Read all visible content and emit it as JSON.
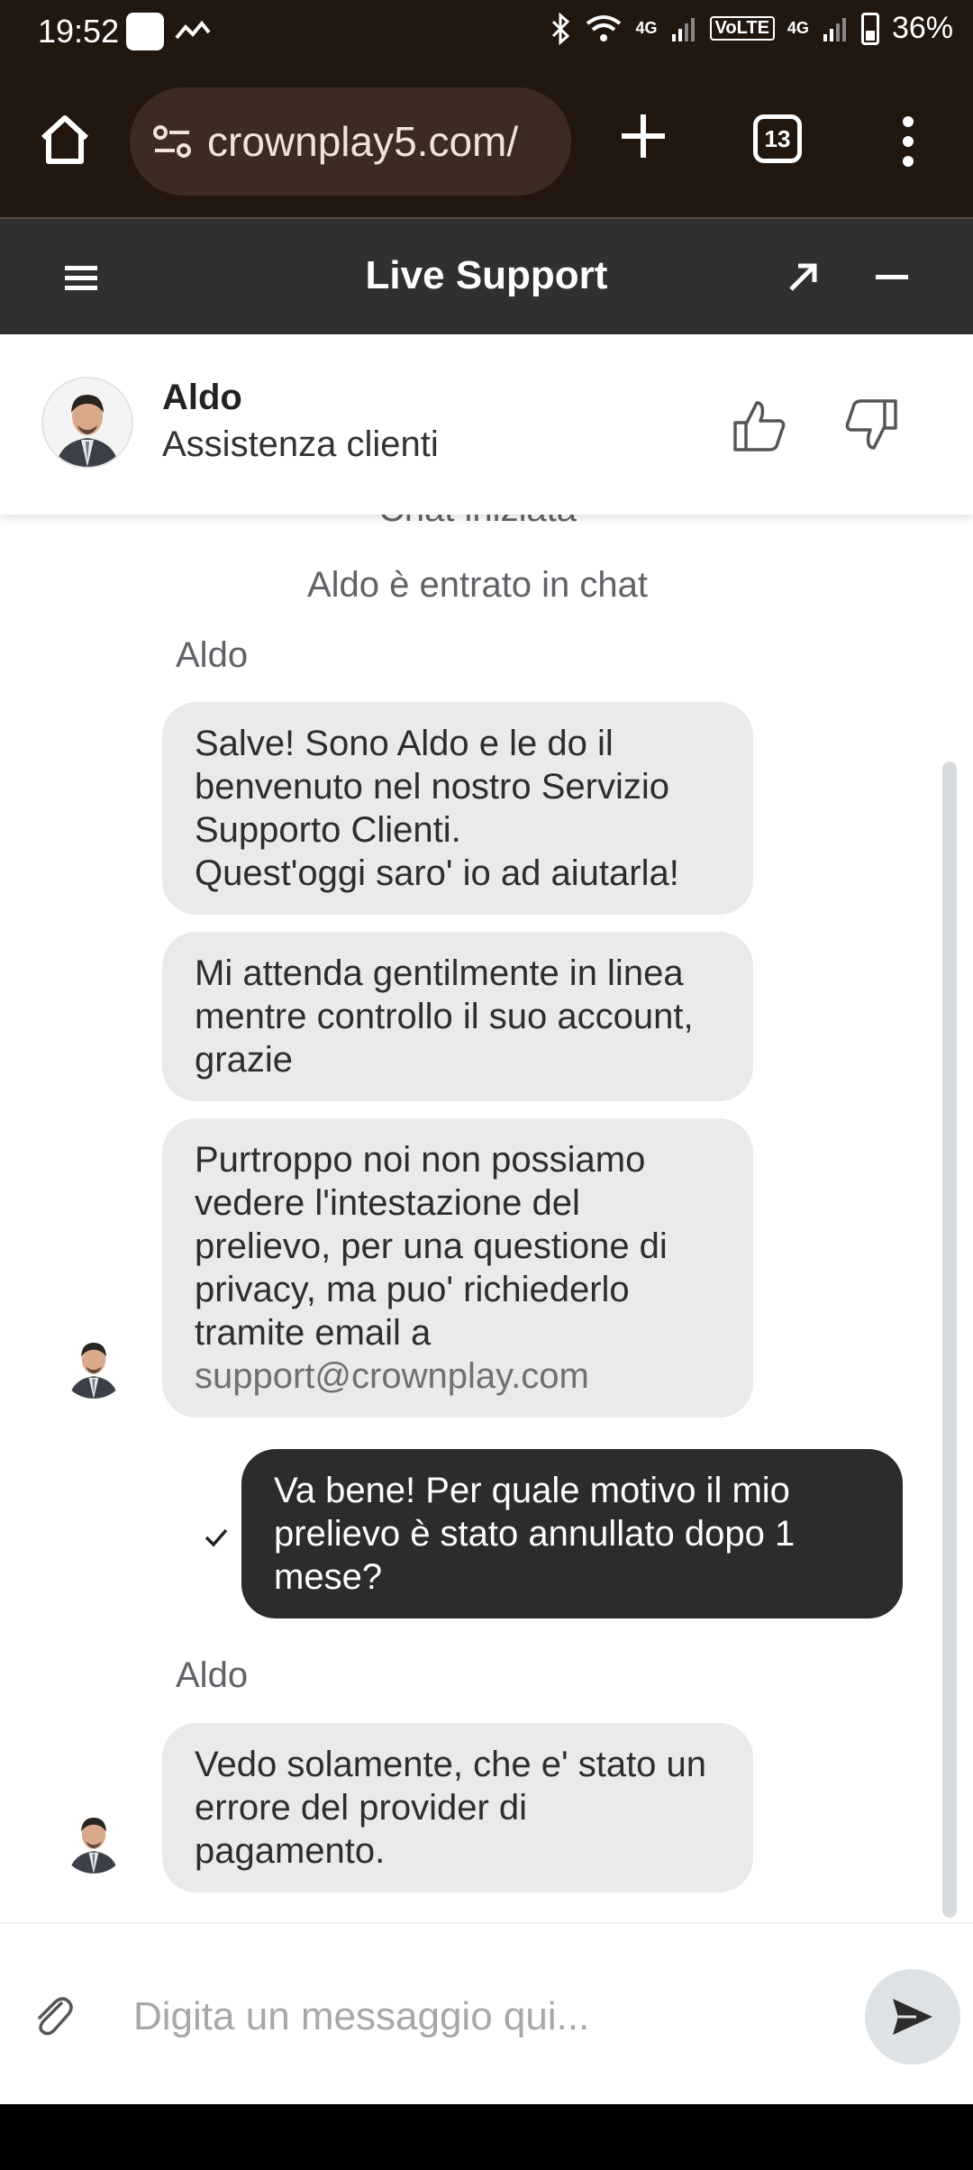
{
  "status_bar": {
    "time": "19:52",
    "network_1": "4G",
    "volte": "VoLTE",
    "network_2": "4G",
    "battery": "36%"
  },
  "browser": {
    "url": "crownplay5.com/",
    "tab_count": "13"
  },
  "support_header": {
    "title": "Live Support"
  },
  "agent": {
    "name": "Aldo",
    "role": "Assistenza clienti"
  },
  "chat": {
    "system_started": "Chat iniziata",
    "system_joined": "Aldo è entrato in chat",
    "sender_1": "Aldo",
    "msg_1_line_1": "Salve! Sono Aldo e le do il benvenuto nel nostro Servizio Supporto Clienti.",
    "msg_1_line_2": "Quest'oggi saro' io ad aiutarla!",
    "msg_2": "Mi attenda gentilmente in linea mentre controllo il suo account, grazie",
    "msg_3": "Purtroppo noi non possiamo vedere l'intestazione del prelievo, per una questione di privacy, ma puo' richiederlo tramite email a",
    "msg_3_link": "support@crownplay.com",
    "user_msg": "Va bene! Per quale motivo il mio prelievo è stato annullato dopo 1 mese?",
    "sender_2": "Aldo",
    "msg_4": "Vedo solamente, che e' stato un errore del provider di pagamento."
  },
  "composer": {
    "placeholder": "Digita un messaggio qui..."
  }
}
